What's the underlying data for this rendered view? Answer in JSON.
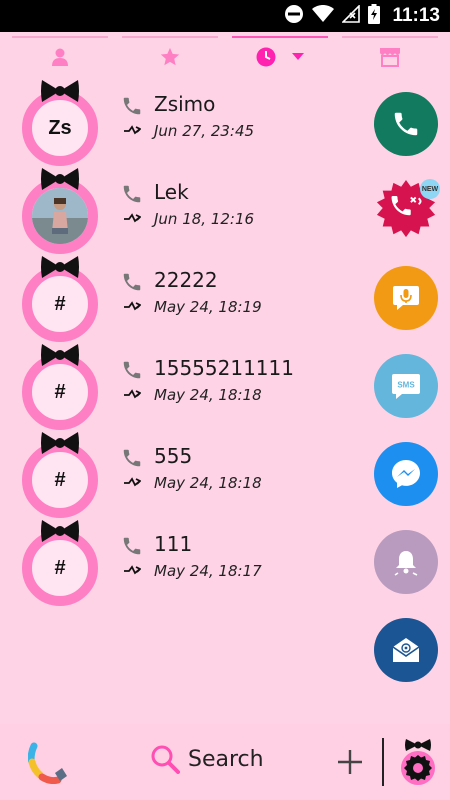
{
  "status_bar": {
    "time": "11:13"
  },
  "tabs": [
    {
      "name": "contacts",
      "icon": "person-icon",
      "active": false
    },
    {
      "name": "favorites",
      "icon": "star-icon",
      "active": false
    },
    {
      "name": "recents",
      "icon": "clock-icon",
      "active": true
    },
    {
      "name": "store",
      "icon": "store-icon",
      "active": false
    }
  ],
  "calls": [
    {
      "initials": "Zs",
      "name": "Zsimo",
      "date": "Jun 27, 23:45"
    },
    {
      "initials": "",
      "name": "Lek",
      "date": "Jun 18, 12:16"
    },
    {
      "initials": "#",
      "name": "22222",
      "date": "May 24, 18:19"
    },
    {
      "initials": "#",
      "name": "15555211111",
      "date": "May 24, 18:18"
    },
    {
      "initials": "#",
      "name": "555",
      "date": "May 24, 18:18"
    },
    {
      "initials": "#",
      "name": "111",
      "date": "May 24, 18:17"
    }
  ],
  "quick_actions": [
    {
      "name": "phone-icon",
      "color": "#117a5f"
    },
    {
      "name": "fun-call-icon",
      "color": "#d6134e",
      "badge": "NEW"
    },
    {
      "name": "voice-message-icon",
      "color": "#f39a14"
    },
    {
      "name": "sms-icon",
      "color": "#64b6dc",
      "label": "SMS"
    },
    {
      "name": "messenger-icon",
      "color": "#1d8ff0"
    },
    {
      "name": "bell-icon",
      "color": "#b89bbe"
    },
    {
      "name": "email-icon",
      "color": "#1c5593"
    }
  ],
  "bottom_bar": {
    "search_label": "Search"
  },
  "colors": {
    "background": "#ffd3e6",
    "ring": "#ff7fc4",
    "accent": "#ff56b9"
  }
}
